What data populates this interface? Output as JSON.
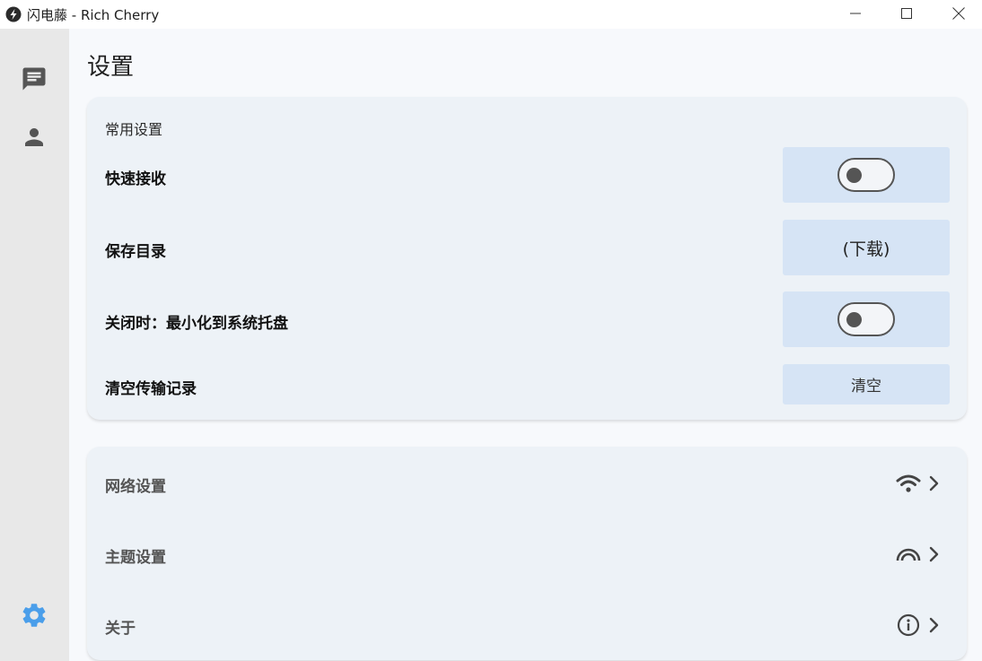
{
  "window": {
    "title": "闪电藤 - Rich Cherry"
  },
  "sidebar": {
    "items": [
      {
        "name": "chat",
        "icon": "message-icon"
      },
      {
        "name": "contacts",
        "icon": "person-icon"
      },
      {
        "name": "settings",
        "icon": "gear-icon",
        "active": true
      }
    ]
  },
  "page": {
    "title": "设置"
  },
  "common": {
    "section_label": "常用设置",
    "quick_receive": {
      "label": "快速接收",
      "enabled": false
    },
    "save_dir": {
      "label": "保存目录",
      "value": "(下载)"
    },
    "minimize_on_close": {
      "label": "关闭时：最小化到系统托盘",
      "enabled": false
    },
    "clear_history": {
      "label": "清空传输记录",
      "button": "清空"
    }
  },
  "nav": {
    "network": {
      "label": "网络设置",
      "icon": "wifi-icon"
    },
    "theme": {
      "label": "主题设置",
      "icon": "rainbow-icon"
    },
    "about": {
      "label": "关于",
      "icon": "info-icon"
    }
  },
  "colors": {
    "accent": "#4a9eea",
    "control_bg": "#d6e4f5",
    "card_bg": "#edf2f7",
    "sidebar_bg": "#e8e8e8"
  }
}
